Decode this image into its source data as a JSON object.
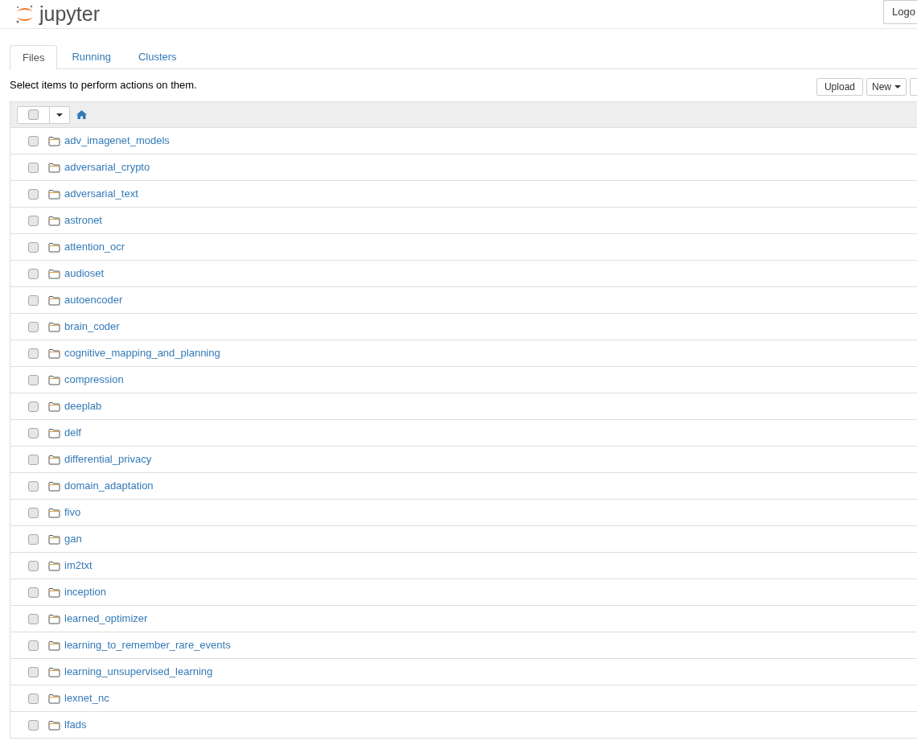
{
  "header": {
    "logo_text": "jupyter",
    "logout_button": "Logo"
  },
  "tabs": [
    {
      "label": "Files",
      "selected": true
    },
    {
      "label": "Running",
      "selected": false
    },
    {
      "label": "Clusters",
      "selected": false
    }
  ],
  "hint": "Select items to perform actions on them.",
  "actions": {
    "upload": "Upload",
    "new": "New"
  },
  "list_header": {
    "checked": false
  },
  "items": [
    {
      "name": "adv_imagenet_models",
      "checked": false
    },
    {
      "name": "adversarial_crypto",
      "checked": false
    },
    {
      "name": "adversarial_text",
      "checked": false
    },
    {
      "name": "astronet",
      "checked": false
    },
    {
      "name": "attention_ocr",
      "checked": false
    },
    {
      "name": "audioset",
      "checked": false
    },
    {
      "name": "autoencoder",
      "checked": false
    },
    {
      "name": "brain_coder",
      "checked": false
    },
    {
      "name": "cognitive_mapping_and_planning",
      "checked": false
    },
    {
      "name": "compression",
      "checked": false
    },
    {
      "name": "deeplab",
      "checked": false
    },
    {
      "name": "delf",
      "checked": false
    },
    {
      "name": "differential_privacy",
      "checked": false
    },
    {
      "name": "domain_adaptation",
      "checked": false
    },
    {
      "name": "fivo",
      "checked": false
    },
    {
      "name": "gan",
      "checked": false
    },
    {
      "name": "im2txt",
      "checked": false
    },
    {
      "name": "inception",
      "checked": false
    },
    {
      "name": "learned_optimizer",
      "checked": false
    },
    {
      "name": "learning_to_remember_rare_events",
      "checked": false
    },
    {
      "name": "learning_unsupervised_learning",
      "checked": false
    },
    {
      "name": "lexnet_nc",
      "checked": false
    },
    {
      "name": "lfads",
      "checked": false
    }
  ]
}
